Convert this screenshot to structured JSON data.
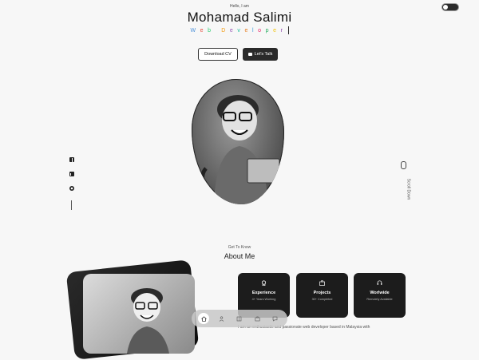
{
  "header": {
    "greeting": "Hello, I am",
    "name": "Mohamad Salimi",
    "role_letters": [
      "W",
      "e",
      "b",
      " ",
      "D",
      "e",
      "v",
      "e",
      "l",
      "o",
      "p",
      "e",
      "r"
    ],
    "role_colors": [
      "#4a90d9",
      "#e74c3c",
      "#2ecc71",
      "#000000",
      "#f39c12",
      "#9b59b6",
      "#1abc9c",
      "#e67e22",
      "#3498db",
      "#e91e63",
      "#27ae60",
      "#f1c40f",
      "#8e44ad"
    ]
  },
  "buttons": {
    "download_cv": "Download CV",
    "lets_talk": "Let's Talk"
  },
  "socials": [
    "facebook-icon",
    "linkedin-icon",
    "github-icon"
  ],
  "scroll": {
    "label": "Scroll Down"
  },
  "about": {
    "kicker": "Get To Know",
    "title": "About Me"
  },
  "stats": [
    {
      "icon": "award-icon",
      "title": "Experience",
      "subtitle": "4+ Years Working"
    },
    {
      "icon": "briefcase-icon",
      "title": "Projects",
      "subtitle": "30+ Completed"
    },
    {
      "icon": "headset-icon",
      "title": "Worlwide",
      "subtitle": "Remotely Available"
    }
  ],
  "bio": "I am an enthusiastic and passionate web developer based in Malaysia with",
  "dock": {
    "items": [
      "home-icon",
      "user-icon",
      "book-icon",
      "briefcase-icon",
      "message-icon"
    ],
    "active": "home-icon"
  }
}
